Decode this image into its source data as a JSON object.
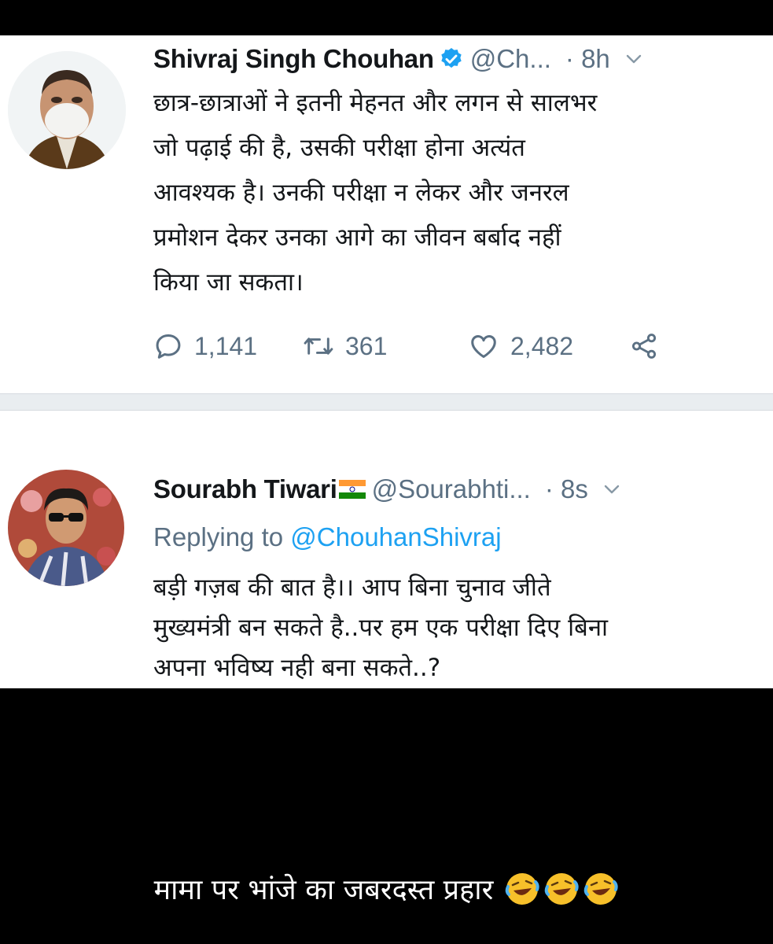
{
  "tweets": [
    {
      "name": "Shivraj Singh Chouhan",
      "handle": "@Ch...",
      "time": "· 8h",
      "verified": true,
      "lines": [
        "छात्र-छात्राओं ने इतनी मेहनत और लगन से सालभर",
        "जो पढ़ाई की है, उसकी परीक्षा होना अत्यंत",
        "आवश्यक है। उनकी परीक्षा न लेकर और जनरल",
        "प्रमोशन देकर उनका आगे का जीवन बर्बाद नहीं",
        "किया जा सकता।"
      ],
      "replies": "1,141",
      "retweets": "361",
      "likes": "2,482"
    },
    {
      "name": "Sourabh Tiwari",
      "handle": "@Sourabhti...",
      "time": "· 8s",
      "replying_label": "Replying to",
      "replying_to": "@ChouhanShivraj",
      "lines": [
        "बड़ी गज़ब की बात है।। आप बिना चुनाव जीते",
        "मुख्यमंत्री बन सकते है..पर हम एक परीक्षा दिए बिना",
        "अपना भविष्य नही बना सकते..?"
      ]
    }
  ],
  "caption": "मामा पर भांजे का जबरदस्त प्रहार",
  "icons": [
    "verified-icon",
    "chevron-down-icon",
    "reply-icon",
    "retweet-icon",
    "like-icon",
    "share-icon",
    "india-flag-icon",
    "laughing-emoji-icon"
  ],
  "colors": {
    "text": "#14171a",
    "secondary": "#5b7083",
    "link": "#1da1f2",
    "verified": "#1da1f2",
    "background": "#ffffff",
    "frame": "#000000"
  }
}
